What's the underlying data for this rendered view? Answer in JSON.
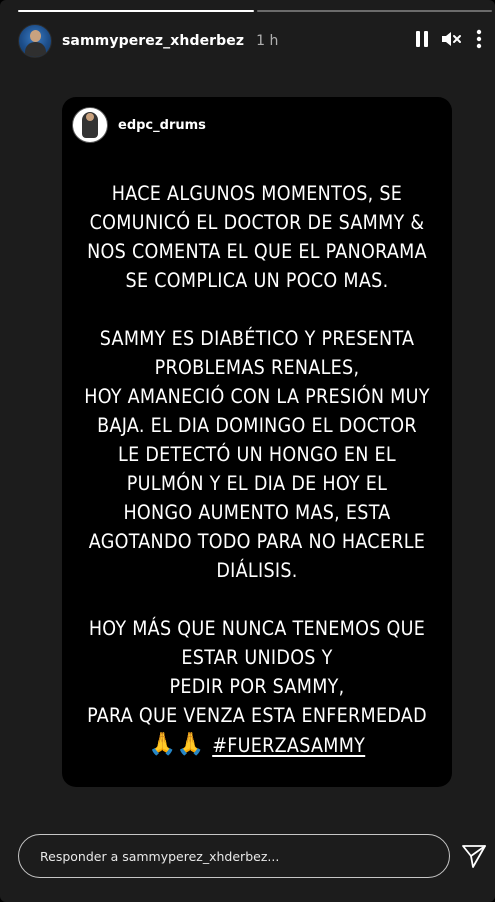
{
  "progress": {
    "segments": [
      {
        "fill": 1.0
      },
      {
        "fill": 0.0
      }
    ]
  },
  "header": {
    "username": "sammyperez_xhderbez",
    "time": "1 h",
    "avatar_icon": "profile-photo",
    "pause_icon": "pause-icon",
    "mute_icon": "volume-muted-icon",
    "more_icon": "more-options-icon"
  },
  "shared_post": {
    "username": "edpc_drums",
    "paragraphs": [
      [
        "HACE ALGUNOS MOMENTOS, SE",
        "COMUNICÓ EL DOCTOR DE SAMMY  &",
        "NOS COMENTA EL QUE EL PANORAMA",
        "SE COMPLICA UN POCO MAS."
      ],
      [
        "SAMMY ES DIABÉTICO Y PRESENTA",
        "PROBLEMAS RENALES,",
        "HOY AMANECIÓ CON LA PRESIÓN MUY",
        "BAJA. EL DIA DOMINGO EL DOCTOR",
        "LE DETECTÓ UN HONGO EN EL",
        "PULMÓN Y EL DIA DE HOY EL",
        "HONGO AUMENTO MAS, ESTA",
        "AGOTANDO TODO PARA NO HACERLE",
        "DIÁLISIS."
      ],
      [
        "HOY MÁS QUE NUNCA TENEMOS QUE",
        "ESTAR UNIDOS Y",
        "PEDIR POR SAMMY,",
        "PARA QUE VENZA ESTA ENFERMEDAD"
      ]
    ],
    "emoji": "🙏🙏",
    "hashtag": "#FUERZASAMMY"
  },
  "reply": {
    "placeholder": "Responder a sammyperez_xhderbez..."
  },
  "send_icon": "send-icon",
  "colors": {
    "story_bg": "#1c1c1c",
    "post_bg": "#000000",
    "text": "#ffffff"
  }
}
